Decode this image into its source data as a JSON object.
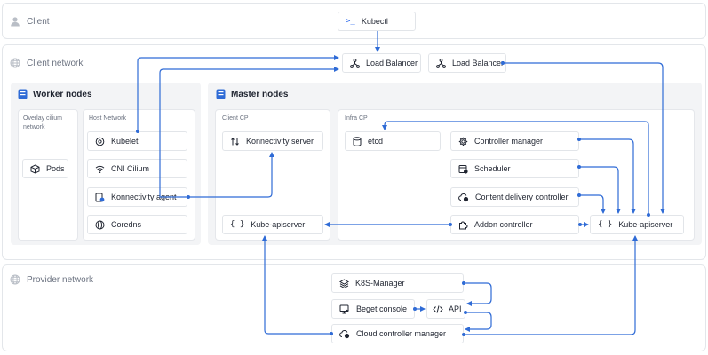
{
  "zones": {
    "client": "Client",
    "client_network": "Client network",
    "provider_network": "Provider network"
  },
  "sections": {
    "worker_nodes": "Worker nodes",
    "master_nodes": "Master nodes",
    "overlay": "Overlay cilium network",
    "host_network": "Host Network",
    "client_cp": "Client CP",
    "infra_cp": "Infra CP"
  },
  "nodes": {
    "kubectl": "Kubectl",
    "lb1": "Load Balancer",
    "lb2": "Load Balancer",
    "pods": "Pods",
    "kubelet": "Kubelet",
    "cni": "CNI Cilium",
    "konn_agent": "Konnectivity agent",
    "coredns": "Coredns",
    "konn_server": "Konnectivity server",
    "apiserver_client": "Kube-apiserver",
    "etcd": "etcd",
    "controller_manager": "Controller manager",
    "scheduler": "Scheduler",
    "content_delivery": "Content delivery controller",
    "addon_controller": "Addon controller",
    "apiserver_infra": "Kube-apiserver",
    "k8s_manager": "K8S-Manager",
    "beget_console": "Beget console",
    "api": "API",
    "cloud_controller": "Cloud controller manager"
  },
  "colors": {
    "accent": "#2f6bd6",
    "border": "#e3e6ea",
    "panel": "#f3f4f6"
  },
  "icons": {
    "client": "user-icon",
    "network": "globe-icon",
    "worker": "server-icon",
    "kubectl": "terminal-icon",
    "lb": "load-balancer-icon",
    "pods": "cube-icon",
    "kubelet": "gear-badge-icon",
    "cni": "wifi-icon",
    "agent": "agent-icon",
    "dns": "globe-icon",
    "konn_server": "link-icon",
    "braces": "braces-icon",
    "etcd": "database-icon",
    "gear": "gear-icon",
    "scheduler": "scheduler-icon",
    "cdc": "cloud-gear-icon",
    "addon": "puzzle-icon",
    "layers": "layers-icon",
    "console": "monitor-icon",
    "code": "code-icon",
    "cloud": "cloud-gear-icon"
  }
}
